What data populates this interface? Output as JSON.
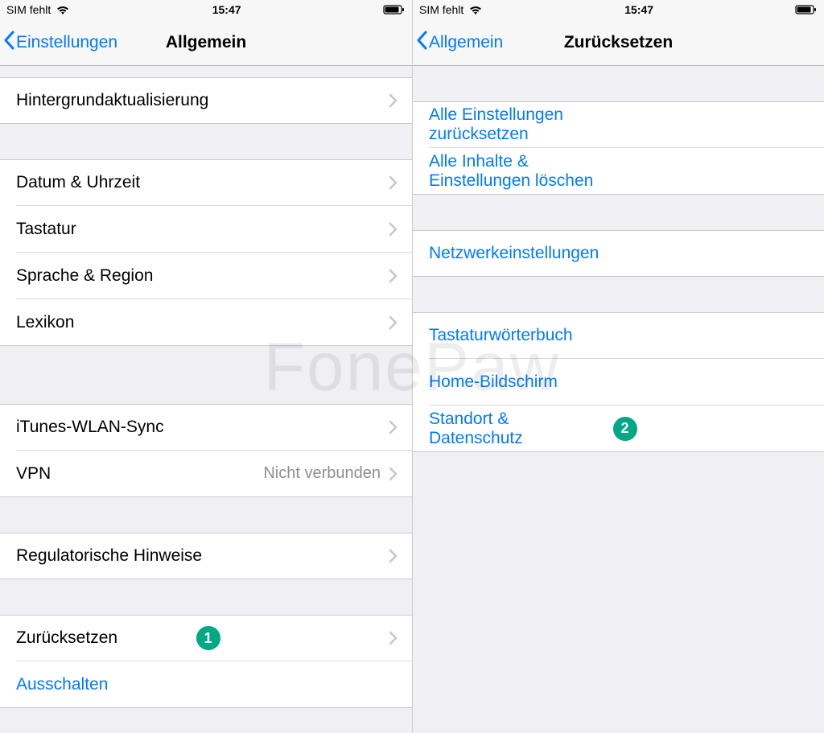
{
  "watermark": "FonePaw",
  "left": {
    "status": {
      "carrier": "SIM fehlt",
      "time": "15:47"
    },
    "nav": {
      "back": "Einstellungen",
      "title": "Allgemein"
    },
    "groups": [
      {
        "gap": "tiny",
        "rows": [
          {
            "label": "Hintergrundaktualisierung",
            "chevron": true
          }
        ]
      },
      {
        "gap": "normal",
        "rows": [
          {
            "label": "Datum & Uhrzeit",
            "chevron": true
          },
          {
            "label": "Tastatur",
            "chevron": true
          },
          {
            "label": "Sprache & Region",
            "chevron": true
          },
          {
            "label": "Lexikon",
            "chevron": true
          }
        ]
      },
      {
        "gap": "big",
        "rows": [
          {
            "label": "iTunes-WLAN-Sync",
            "chevron": true
          },
          {
            "label": "VPN",
            "value": "Nicht verbunden",
            "chevron": true
          }
        ]
      },
      {
        "gap": "normal",
        "rows": [
          {
            "label": "Regulatorische Hinweise",
            "chevron": true
          }
        ]
      },
      {
        "gap": "normal",
        "rows": [
          {
            "label": "Zurücksetzen",
            "chevron": true,
            "badge": "1"
          },
          {
            "label": "Ausschalten",
            "blue": true,
            "chevron": false
          }
        ]
      }
    ]
  },
  "right": {
    "status": {
      "carrier": "SIM fehlt",
      "time": "15:47"
    },
    "nav": {
      "back": "Allgemein",
      "title": "Zurücksetzen"
    },
    "groups": [
      {
        "gap": "normal",
        "rows": [
          {
            "label": "Alle Einstellungen zurücksetzen",
            "blue": true,
            "chevron": false
          },
          {
            "label": "Alle Inhalte & Einstellungen löschen",
            "blue": true,
            "chevron": false
          }
        ]
      },
      {
        "gap": "normal",
        "rows": [
          {
            "label": "Netzwerkeinstellungen",
            "blue": true,
            "chevron": false
          }
        ]
      },
      {
        "gap": "normal",
        "rows": [
          {
            "label": "Tastaturwörterbuch",
            "blue": true,
            "chevron": false
          },
          {
            "label": "Home-Bildschirm",
            "blue": true,
            "chevron": false
          },
          {
            "label": "Standort & Datenschutz",
            "blue": true,
            "chevron": false,
            "badge": "2"
          }
        ]
      }
    ]
  }
}
